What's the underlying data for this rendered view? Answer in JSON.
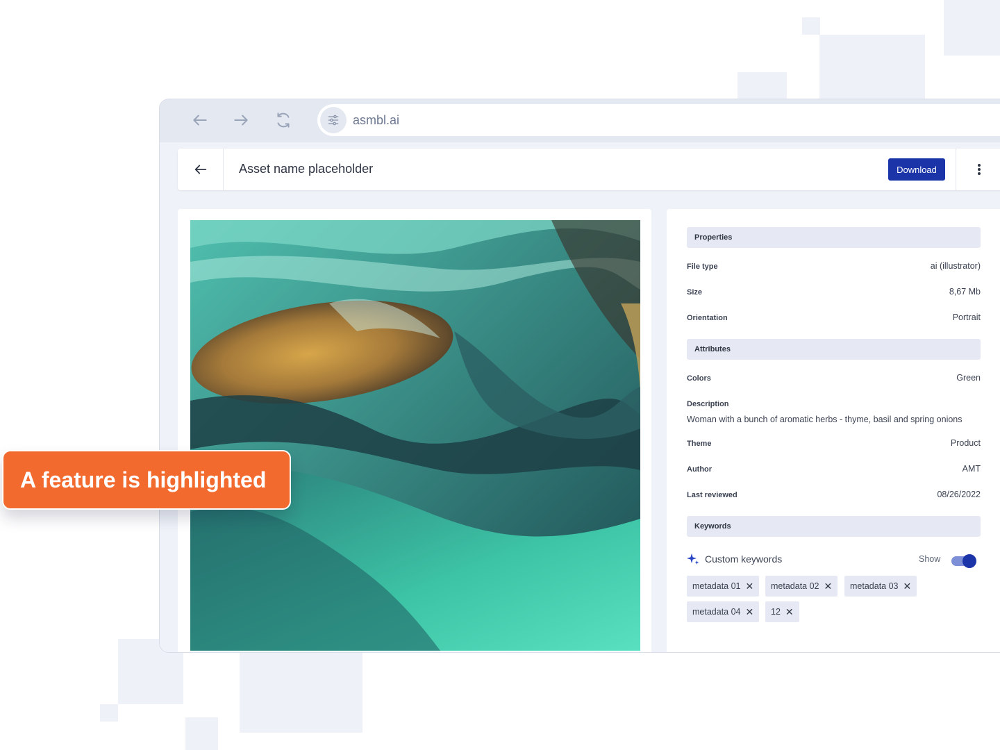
{
  "browser": {
    "url": "asmbl.ai",
    "icons": [
      "back-arrow-icon",
      "forward-arrow-icon",
      "reload-icon",
      "settings-sliders-icon"
    ]
  },
  "header": {
    "title": "Asset name placeholder",
    "download_label": "Download"
  },
  "properties": {
    "heading": "Properties",
    "file_type_label": "File type",
    "file_type_value": "ai (illustrator)",
    "size_label": "Size",
    "size_value": "8,67 Mb",
    "orientation_label": "Orientation",
    "orientation_value": "Portrait"
  },
  "attributes": {
    "heading": "Attributes",
    "colors_label": "Colors",
    "colors_value": "Green",
    "description_label": "Description",
    "description_value": "Woman with a bunch of aromatic herbs - thyme, basil and spring onions",
    "theme_label": "Theme",
    "theme_value": "Product",
    "author_label": "Author",
    "author_value": "AMT",
    "last_reviewed_label": "Last reviewed",
    "last_reviewed_value": "08/26/2022"
  },
  "keywords": {
    "heading": "Keywords",
    "custom_title": "Custom keywords",
    "show_label": "Show",
    "show_enabled": true,
    "chips": [
      "metadata 01",
      "metadata 02",
      "metadata 03",
      "metadata 04",
      "12"
    ],
    "remove_glyph": "✕"
  },
  "callout": {
    "text": "A feature is highlighted",
    "color": "#f26a2e"
  },
  "colors": {
    "accent": "#1b35a8",
    "panel_bg": "#eff2f8"
  }
}
